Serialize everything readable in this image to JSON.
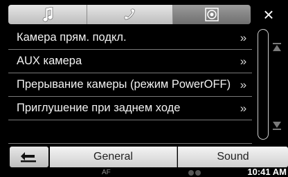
{
  "tabs": [
    {
      "icon": "music-note-icon"
    },
    {
      "icon": "phone-icon"
    },
    {
      "icon": "camera-disc-icon",
      "active": true
    }
  ],
  "close": {
    "icon": "close-icon",
    "label": "×"
  },
  "list": {
    "items": [
      {
        "label": "Камера прям. подкл.",
        "chevron": "»"
      },
      {
        "label": "AUX камера",
        "chevron": "»"
      },
      {
        "label": "Прерывание камеры (режим PowerOFF)",
        "chevron": "»"
      },
      {
        "label": "Приглушение при заднем ходе",
        "chevron": "»"
      },
      {
        "label": ""
      }
    ]
  },
  "scrollbar": {
    "up_icon": "scroll-up-icon",
    "down_icon": "scroll-down-icon"
  },
  "bottom": {
    "back_icon": "back-arrow-icon",
    "general_label": "General",
    "sound_label": "Sound"
  },
  "status": {
    "af": "AF",
    "time": "10:41 AM"
  }
}
